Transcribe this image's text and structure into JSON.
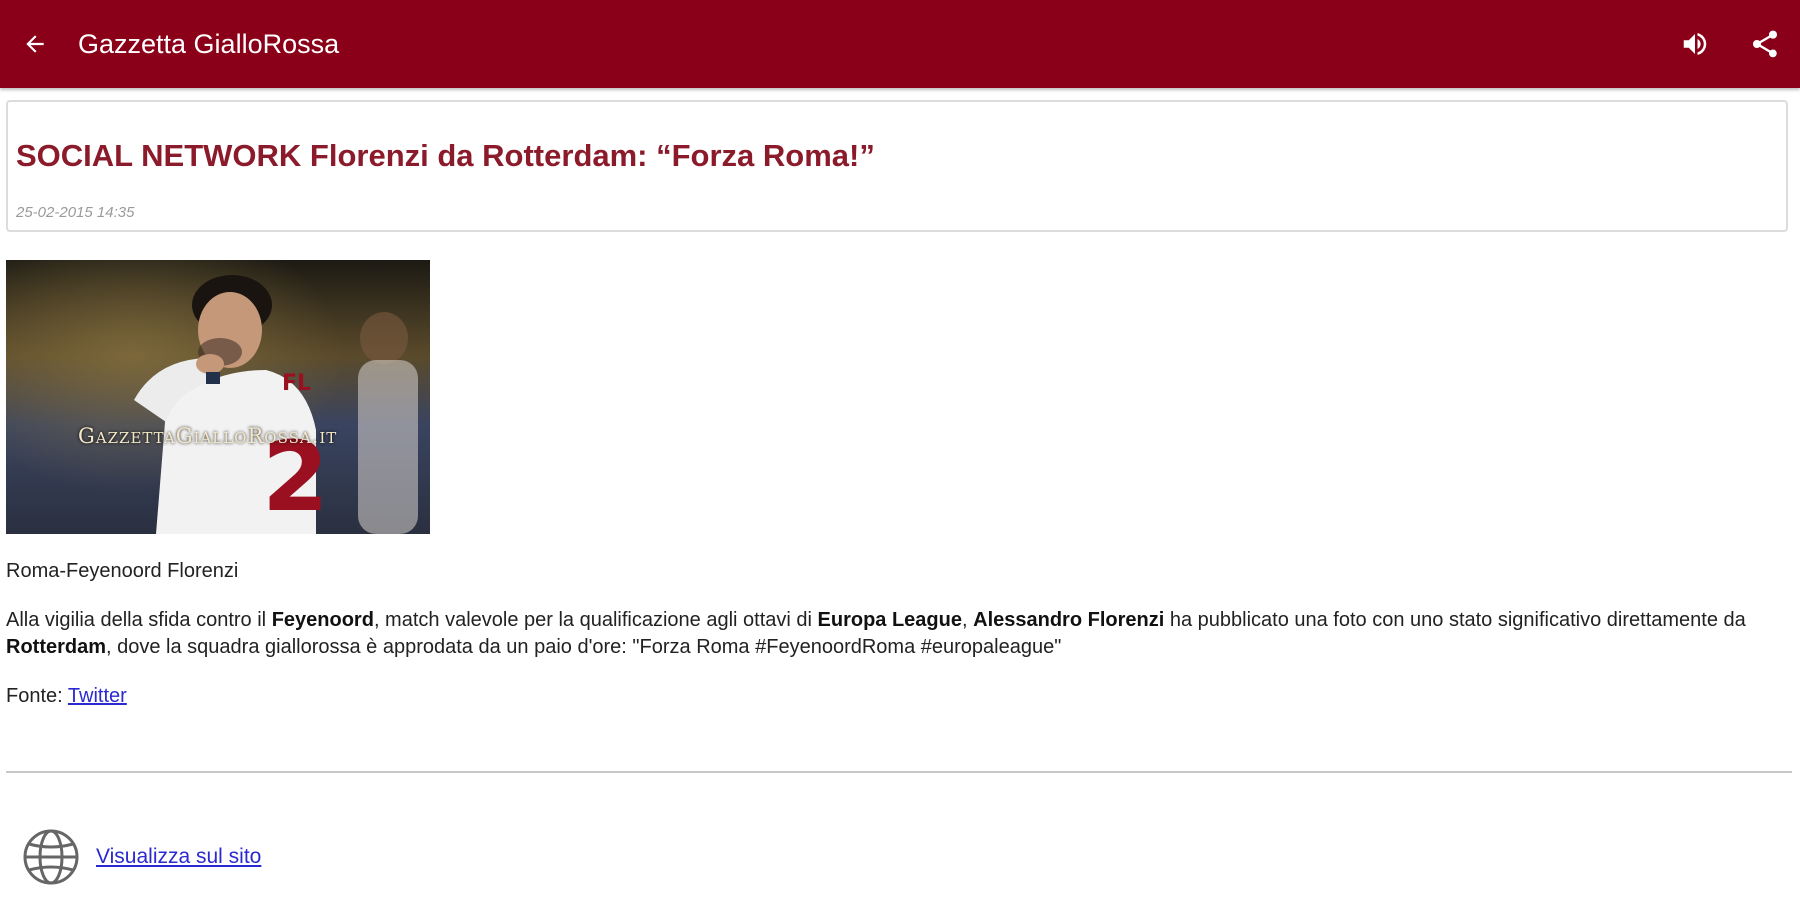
{
  "app_bar": {
    "title": "Gazzetta GialloRossa",
    "back_icon": "arrow-left-icon",
    "volume_icon": "volume-icon",
    "share_icon": "share-icon",
    "color": "#8b0019"
  },
  "article": {
    "headline": "SOCIAL NETWORK Florenzi da Rotterdam: “Forza Roma!”",
    "date": "25-02-2015 14:35",
    "image_watermark": "GazzettaGialloRossa.it",
    "image_caption": "Roma-Feyenoord Florenzi",
    "body": {
      "p1": "Alla vigilia della sfida contro il ",
      "b1": "Feyenoord",
      "p2": ", match valevole per la qualificazione agli ottavi di ",
      "b2": "Europa League",
      "p3": ", ",
      "b3": "Alessandro Florenzi",
      "p4": " ha pubblicato una foto con uno stato significativo direttamente da ",
      "b4": "Rotterdam",
      "p5": ", dove la squadra giallorossa è approdata da un paio d'ore: \"Forza Roma #FeyenoordRoma #europaleague\""
    },
    "source_label": "Fonte: ",
    "source_link": "Twitter",
    "headline_color": "#8b1a2a"
  },
  "footer": {
    "site_link": "Visualizza sul sito",
    "globe_icon": "globe-icon"
  }
}
